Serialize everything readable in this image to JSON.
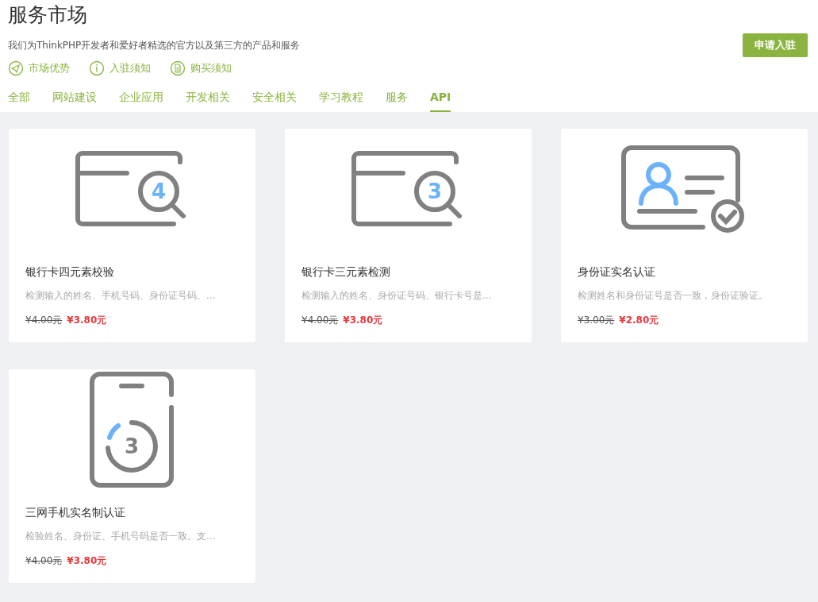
{
  "title": "服务市场",
  "subtitle": "我们为ThinkPHP开发者和爱好者精选的官方以及第三方的产品和服务",
  "apply_button": "申请入驻",
  "info_links": [
    {
      "kind": "plane",
      "label": "市场优势"
    },
    {
      "kind": "info",
      "label": "入驻须知"
    },
    {
      "kind": "doc",
      "label": "购买须知"
    }
  ],
  "tabs": [
    {
      "label": "全部",
      "selected": false
    },
    {
      "label": "网站建设",
      "selected": false
    },
    {
      "label": "企业应用",
      "selected": false
    },
    {
      "label": "开发相关",
      "selected": false
    },
    {
      "label": "安全相关",
      "selected": false
    },
    {
      "label": "学习教程",
      "selected": false
    },
    {
      "label": "服务",
      "selected": false
    },
    {
      "label": "API",
      "selected": true
    }
  ],
  "products": [
    {
      "kind": "card-search",
      "icon_number": "4",
      "name": "银行卡四元素校验",
      "description": "检测输入的姓名、手机号码、身份证号码、...",
      "old_price": "¥4.00元",
      "price": "¥3.80元"
    },
    {
      "kind": "card-search",
      "icon_number": "3",
      "name": "银行卡三元素检测",
      "description": "检测输入的姓名、身份证号码、银行卡号是...",
      "old_price": "¥4.00元",
      "price": "¥3.80元"
    },
    {
      "kind": "id-card",
      "name": "身份证实名认证",
      "description": "检测姓名和身份证号是否一致，身份证验证。",
      "old_price": "¥3.00元",
      "price": "¥2.80元"
    },
    {
      "kind": "phone",
      "icon_number": "3",
      "name": "三网手机实名制认证",
      "description": "检验姓名、身份证、手机号码是否一致。支...",
      "old_price": "¥4.00元",
      "price": "¥3.80元"
    }
  ]
}
